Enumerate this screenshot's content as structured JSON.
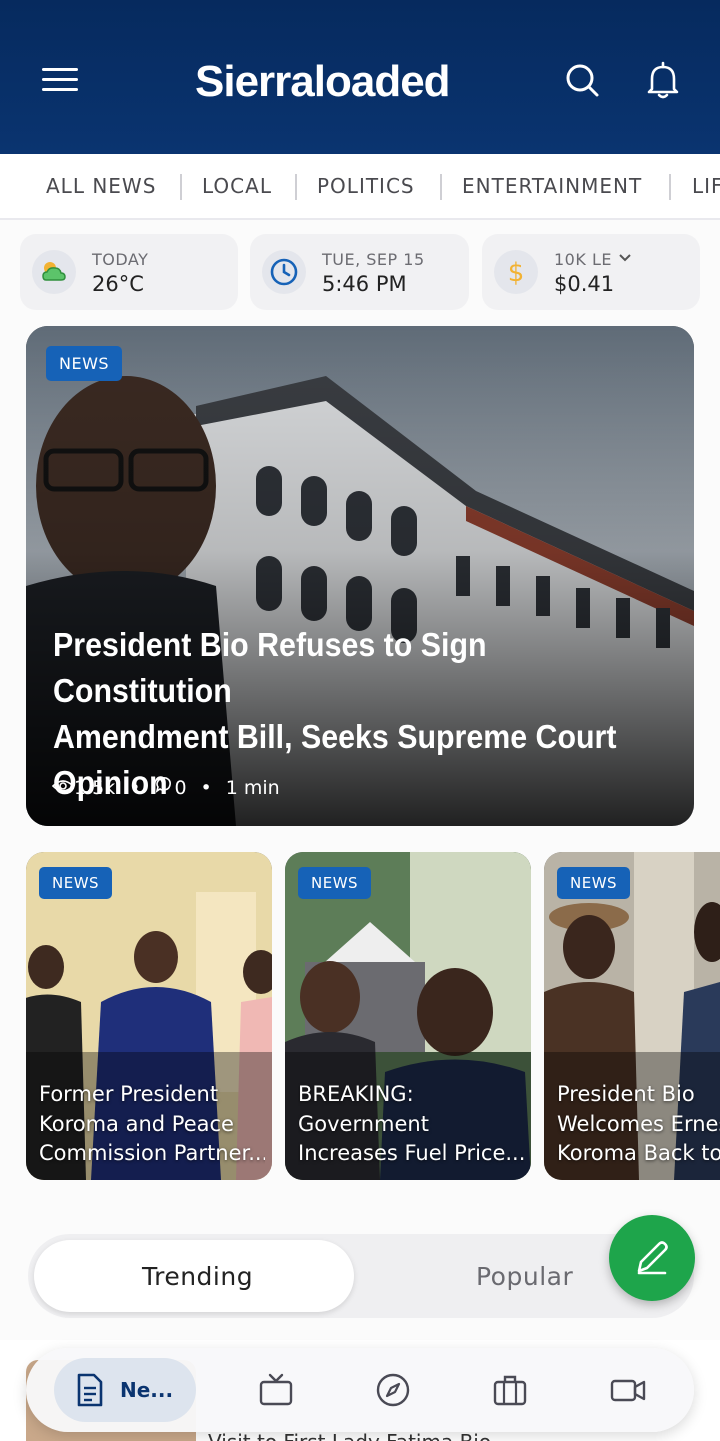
{
  "header": {
    "logo_text": "Sierraloaded",
    "menu_icon": "hamburger-menu-icon",
    "search_icon": "search-icon",
    "notification_icon": "bell-icon",
    "background_color": "#062a5e"
  },
  "tabs": [
    "ALL NEWS",
    "LOCAL",
    "POLITICS",
    "ENTERTAINMENT",
    "LIF"
  ],
  "widgets": {
    "weather": {
      "label": "TODAY",
      "value": "26°C",
      "icon": "weather-icon"
    },
    "datetime": {
      "label": "TUE, SEP 15",
      "value": "5:46 PM",
      "icon": "clock-icon"
    },
    "currency": {
      "label": "10K LE",
      "value": "$0.41",
      "icon": "dollar-icon"
    }
  },
  "hero": {
    "badge": "NEWS",
    "title_lines": [
      "President Bio Refuses to Sign Constitution",
      "Amendment Bill, Seeks Supreme Court",
      "Opinion"
    ],
    "views": "1.5k",
    "comments": "0",
    "read_time": "1 min"
  },
  "cards": [
    {
      "badge": "NEWS",
      "lines": [
        "Former President",
        "Koroma and Peace",
        "Commission Partner..."
      ]
    },
    {
      "badge": "NEWS",
      "lines": [
        "BREAKING:",
        "Government",
        "Increases Fuel Price..."
      ]
    },
    {
      "badge": "NEWS",
      "lines": [
        "President Bio",
        "Welcomes Ernest",
        "Koroma Back to"
      ]
    }
  ],
  "segments": {
    "trending": "Trending",
    "popular": "Popular",
    "active": "Trending"
  },
  "fab_icon": "pencil-icon",
  "bottom_nav": {
    "active_label": "Ne...",
    "items": [
      "document-icon",
      "tv-icon",
      "compass-icon",
      "briefcase-icon",
      "video-camera-icon"
    ]
  },
  "peek_text": "Visit to First Lady Fatima Bio",
  "colors": {
    "accent_blue": "#1662b7",
    "fab_green": "#1ea54b",
    "header_navy": "#062a5e"
  }
}
